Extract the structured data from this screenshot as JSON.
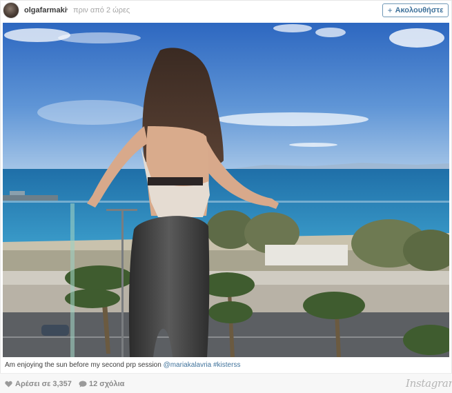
{
  "header": {
    "username": "olgafarmaki",
    "separator": "•",
    "time_ago": "πριν από 2 ώρες",
    "follow_label": "Ακολουθήστε",
    "follow_icon": "plus-icon"
  },
  "post": {
    "image_alt": "Photo",
    "caption_text": "Am enjoying the sun before my second prp session ",
    "mention": "@mariakalavria",
    "hashtag": "#kisterss"
  },
  "footer": {
    "likes_label": "Αρέσει σε 3,357",
    "comments_label": "12 σχόλια",
    "brand": "Instagram",
    "like_icon": "heart-icon",
    "comment_icon": "speech-bubble-icon"
  },
  "colors": {
    "accent": "#3f729b",
    "muted": "#a5a5a5",
    "sky_top": "#2f6fc4",
    "sea": "#2a86b8"
  }
}
